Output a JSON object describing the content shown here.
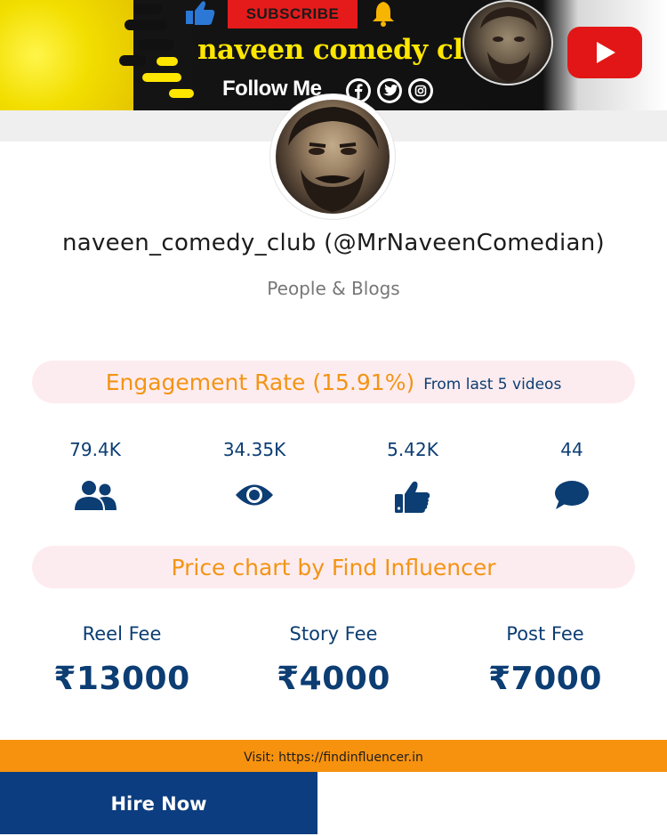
{
  "banner": {
    "subscribe_label": "SUBSCRIBE",
    "channel_title": "naveen comedy club",
    "follow_label": "Follow Me",
    "accent_yellow": "#ffe600",
    "subscribe_red": "#e51b1b"
  },
  "profile": {
    "username": "naveen_comedy_club (@MrNaveenComedian)",
    "category": "People & Blogs"
  },
  "engagement": {
    "title": "Engagement Rate (15.91%)",
    "subtitle": "From last 5 videos"
  },
  "stats": [
    {
      "value": "79.4K",
      "icon": "users-icon"
    },
    {
      "value": "34.35K",
      "icon": "eye-icon"
    },
    {
      "value": "5.42K",
      "icon": "thumbs-up-icon"
    },
    {
      "value": "44",
      "icon": "comment-icon"
    }
  ],
  "price_chart": {
    "title": "Price chart by Find Influencer",
    "fees": [
      {
        "label": "Reel Fee",
        "amount": "₹13000"
      },
      {
        "label": "Story Fee",
        "amount": "₹4000"
      },
      {
        "label": "Post Fee",
        "amount": "₹7000"
      }
    ]
  },
  "footer": {
    "visit_text": "Visit: https://findinfluencer.in",
    "hire_label": "Hire Now"
  },
  "colors": {
    "primary_blue": "#0c3d73",
    "accent_orange": "#f39415",
    "pill_pink": "#fdecef"
  }
}
